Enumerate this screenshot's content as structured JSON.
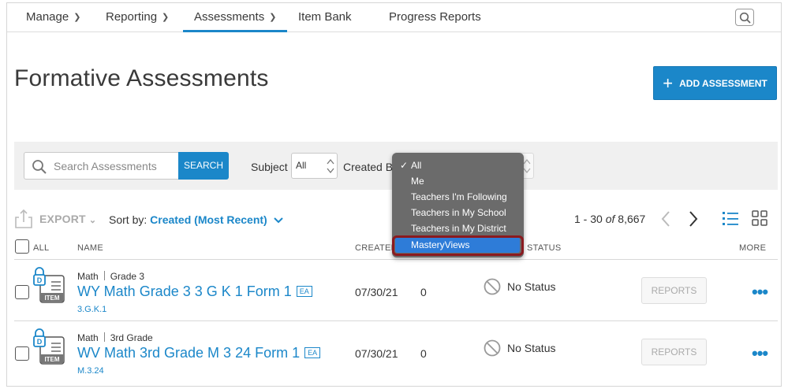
{
  "nav": {
    "items": [
      {
        "label": "Manage",
        "has_menu": true
      },
      {
        "label": "Reporting",
        "has_menu": true
      },
      {
        "label": "Assessments",
        "has_menu": true,
        "active": true
      },
      {
        "label": "Item Bank",
        "has_menu": false
      },
      {
        "label": "Progress Reports",
        "has_menu": false
      }
    ],
    "search_icon": "search-icon"
  },
  "page": {
    "title": "Formative Assessments",
    "add_button": "ADD ASSESSMENT"
  },
  "filters": {
    "search_placeholder": "Search Assessments",
    "search_button": "SEARCH",
    "subject_label": "Subject",
    "subject_value": "All",
    "created_by_label": "Created By"
  },
  "created_by_menu": {
    "options": [
      "All",
      "Me",
      "Teachers I'm Following",
      "Teachers in My School",
      "Teachers in My District",
      "MasteryViews"
    ],
    "selected": "All",
    "highlighted": "MasteryViews"
  },
  "toolbar": {
    "export_label": "EXPORT",
    "sort_label": "Sort by:",
    "sort_value": "Created (Most Recent)",
    "paging_range": "1 - 30",
    "paging_of": "of",
    "paging_total": "8,667"
  },
  "table": {
    "headers": {
      "all": "ALL",
      "name": "NAME",
      "created": "CREATED",
      "status": "STATUS",
      "more": "MORE"
    },
    "rows": [
      {
        "subject": "Math",
        "grade": "Grade 3",
        "title": "WY Math Grade 3 3 G K 1 Form 1",
        "badge": "EA",
        "code": "3.G.K.1",
        "created": "07/30/21",
        "count": "0",
        "status": "No Status",
        "reports": "REPORTS",
        "icon_letter": "D",
        "icon_caption": "ITEM"
      },
      {
        "subject": "Math",
        "grade": "3rd Grade",
        "title": "WV Math 3rd Grade M 3 24 Form 1",
        "badge": "EA",
        "code": "M.3.24",
        "created": "07/30/21",
        "count": "0",
        "status": "No Status",
        "reports": "REPORTS",
        "icon_letter": "D",
        "icon_caption": "ITEM"
      }
    ]
  },
  "colors": {
    "accent": "#1b87c9",
    "menu_bg": "#6b6b6b",
    "menu_highlight": "#2e7cd8",
    "outline": "#8b1a1f"
  }
}
